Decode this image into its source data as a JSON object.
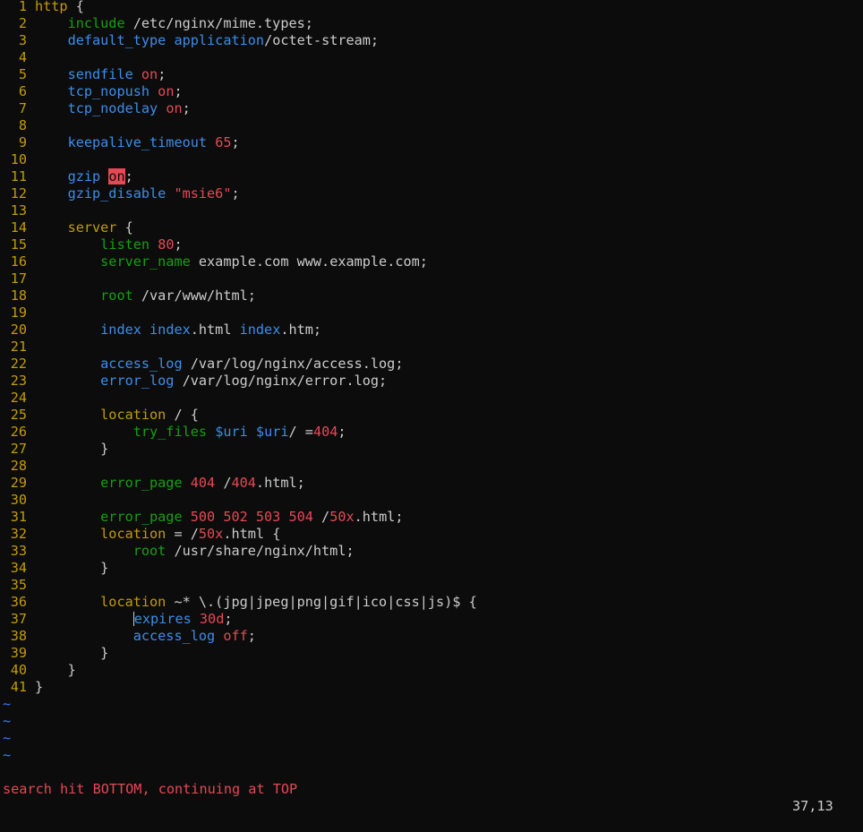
{
  "colors": {
    "background": "#0c0c0c",
    "line_number": "#c19c00",
    "block_keyword": "#c19c00",
    "directive_blue": "#3b8eea",
    "directive_green": "#13a10e",
    "number": "#e74856",
    "string": "#e74856",
    "text": "#cccccc",
    "tilde": "#3b78ff",
    "search_highlight": "#e74856",
    "status_message": "#e74856"
  },
  "cursor": {
    "line": 37,
    "column": 13
  },
  "lines": [
    {
      "n": "1",
      "indent": "",
      "tokens": [
        [
          "block",
          "http"
        ],
        [
          "plain",
          " {"
        ]
      ]
    },
    {
      "n": "2",
      "indent": "    ",
      "tokens": [
        [
          "dir2",
          "include"
        ],
        [
          "plain",
          " /etc/nginx/mime.types;"
        ]
      ]
    },
    {
      "n": "3",
      "indent": "    ",
      "tokens": [
        [
          "dir1",
          "default_type"
        ],
        [
          "plain",
          " "
        ],
        [
          "dir1",
          "application"
        ],
        [
          "plain",
          "/octet-stream;"
        ]
      ]
    },
    {
      "n": "4",
      "indent": "",
      "tokens": []
    },
    {
      "n": "5",
      "indent": "    ",
      "tokens": [
        [
          "dir1",
          "sendfile"
        ],
        [
          "plain",
          " "
        ],
        [
          "num",
          "on"
        ],
        [
          "plain",
          ";"
        ]
      ]
    },
    {
      "n": "6",
      "indent": "    ",
      "tokens": [
        [
          "dir1",
          "tcp_nopush"
        ],
        [
          "plain",
          " "
        ],
        [
          "num",
          "on"
        ],
        [
          "plain",
          ";"
        ]
      ]
    },
    {
      "n": "7",
      "indent": "    ",
      "tokens": [
        [
          "dir1",
          "tcp_nodelay"
        ],
        [
          "plain",
          " "
        ],
        [
          "num",
          "on"
        ],
        [
          "plain",
          ";"
        ]
      ]
    },
    {
      "n": "8",
      "indent": "",
      "tokens": []
    },
    {
      "n": "9",
      "indent": "    ",
      "tokens": [
        [
          "dir1",
          "keepalive_timeout"
        ],
        [
          "plain",
          " "
        ],
        [
          "num",
          "65"
        ],
        [
          "plain",
          ";"
        ]
      ]
    },
    {
      "n": "10",
      "indent": "",
      "tokens": []
    },
    {
      "n": "11",
      "indent": "    ",
      "tokens": [
        [
          "dir1",
          "gzip"
        ],
        [
          "plain",
          " "
        ],
        [
          "search",
          "on"
        ],
        [
          "plain",
          ";"
        ]
      ]
    },
    {
      "n": "12",
      "indent": "    ",
      "tokens": [
        [
          "dir1",
          "gzip_disable"
        ],
        [
          "plain",
          " "
        ],
        [
          "str",
          "\"msie6\""
        ],
        [
          "plain",
          ";"
        ]
      ]
    },
    {
      "n": "13",
      "indent": "",
      "tokens": []
    },
    {
      "n": "14",
      "indent": "    ",
      "tokens": [
        [
          "block",
          "server"
        ],
        [
          "plain",
          " {"
        ]
      ]
    },
    {
      "n": "15",
      "indent": "        ",
      "tokens": [
        [
          "dir2",
          "listen"
        ],
        [
          "plain",
          " "
        ],
        [
          "num",
          "80"
        ],
        [
          "plain",
          ";"
        ]
      ]
    },
    {
      "n": "16",
      "indent": "        ",
      "tokens": [
        [
          "dir2",
          "server_name"
        ],
        [
          "plain",
          " example.com www.example.com;"
        ]
      ]
    },
    {
      "n": "17",
      "indent": "",
      "tokens": []
    },
    {
      "n": "18",
      "indent": "        ",
      "tokens": [
        [
          "dir2",
          "root"
        ],
        [
          "plain",
          " /var/www/html;"
        ]
      ]
    },
    {
      "n": "19",
      "indent": "",
      "tokens": []
    },
    {
      "n": "20",
      "indent": "        ",
      "tokens": [
        [
          "dir1",
          "index"
        ],
        [
          "plain",
          " "
        ],
        [
          "dir1",
          "index"
        ],
        [
          "plain",
          ".html "
        ],
        [
          "dir1",
          "index"
        ],
        [
          "plain",
          ".htm;"
        ]
      ]
    },
    {
      "n": "21",
      "indent": "",
      "tokens": []
    },
    {
      "n": "22",
      "indent": "        ",
      "tokens": [
        [
          "dir1",
          "access_log"
        ],
        [
          "plain",
          " /var/log/nginx/access.log;"
        ]
      ]
    },
    {
      "n": "23",
      "indent": "        ",
      "tokens": [
        [
          "dir1",
          "error_log"
        ],
        [
          "plain",
          " /var/log/nginx/error.log;"
        ]
      ]
    },
    {
      "n": "24",
      "indent": "",
      "tokens": []
    },
    {
      "n": "25",
      "indent": "        ",
      "tokens": [
        [
          "block",
          "location"
        ],
        [
          "plain",
          " / {"
        ]
      ]
    },
    {
      "n": "26",
      "indent": "            ",
      "tokens": [
        [
          "dir2",
          "try_files"
        ],
        [
          "plain",
          " "
        ],
        [
          "var",
          "$uri"
        ],
        [
          "plain",
          " "
        ],
        [
          "var",
          "$uri"
        ],
        [
          "plain",
          "/ ="
        ],
        [
          "num",
          "404"
        ],
        [
          "plain",
          ";"
        ]
      ]
    },
    {
      "n": "27",
      "indent": "        ",
      "tokens": [
        [
          "plain",
          "}"
        ]
      ]
    },
    {
      "n": "28",
      "indent": "",
      "tokens": []
    },
    {
      "n": "29",
      "indent": "        ",
      "tokens": [
        [
          "dir2",
          "error_page"
        ],
        [
          "plain",
          " "
        ],
        [
          "num",
          "404"
        ],
        [
          "plain",
          " /"
        ],
        [
          "num",
          "404"
        ],
        [
          "plain",
          ".html;"
        ]
      ]
    },
    {
      "n": "30",
      "indent": "",
      "tokens": []
    },
    {
      "n": "31",
      "indent": "        ",
      "tokens": [
        [
          "dir2",
          "error_page"
        ],
        [
          "plain",
          " "
        ],
        [
          "num",
          "500 502 503 504"
        ],
        [
          "plain",
          " /"
        ],
        [
          "num",
          "50x"
        ],
        [
          "plain",
          ".html;"
        ]
      ]
    },
    {
      "n": "32",
      "indent": "        ",
      "tokens": [
        [
          "block",
          "location"
        ],
        [
          "plain",
          " = /"
        ],
        [
          "num",
          "50x"
        ],
        [
          "plain",
          ".html {"
        ]
      ]
    },
    {
      "n": "33",
      "indent": "            ",
      "tokens": [
        [
          "dir2",
          "root"
        ],
        [
          "plain",
          " /usr/share/nginx/html;"
        ]
      ]
    },
    {
      "n": "34",
      "indent": "        ",
      "tokens": [
        [
          "plain",
          "}"
        ]
      ]
    },
    {
      "n": "35",
      "indent": "",
      "tokens": []
    },
    {
      "n": "36",
      "indent": "        ",
      "tokens": [
        [
          "block",
          "location"
        ],
        [
          "plain",
          " ~* \\.(jpg|jpeg|png|gif|ico|css|js)$ {"
        ]
      ]
    },
    {
      "n": "37",
      "indent": "            ",
      "tokens": [
        [
          "cursor",
          ""
        ],
        [
          "dir1",
          "expires"
        ],
        [
          "plain",
          " "
        ],
        [
          "num",
          "30d"
        ],
        [
          "plain",
          ";"
        ]
      ]
    },
    {
      "n": "38",
      "indent": "            ",
      "tokens": [
        [
          "dir1",
          "access_log"
        ],
        [
          "plain",
          " "
        ],
        [
          "num",
          "off"
        ],
        [
          "plain",
          ";"
        ]
      ]
    },
    {
      "n": "39",
      "indent": "        ",
      "tokens": [
        [
          "plain",
          "}"
        ]
      ]
    },
    {
      "n": "40",
      "indent": "    ",
      "tokens": [
        [
          "plain",
          "}"
        ]
      ]
    },
    {
      "n": "41",
      "indent": "",
      "tokens": [
        [
          "plain",
          "}"
        ]
      ]
    }
  ],
  "tilde_lines": [
    "~",
    "~",
    "~",
    "~"
  ],
  "status": {
    "message": "search hit BOTTOM, continuing at TOP",
    "position": "37,13"
  }
}
